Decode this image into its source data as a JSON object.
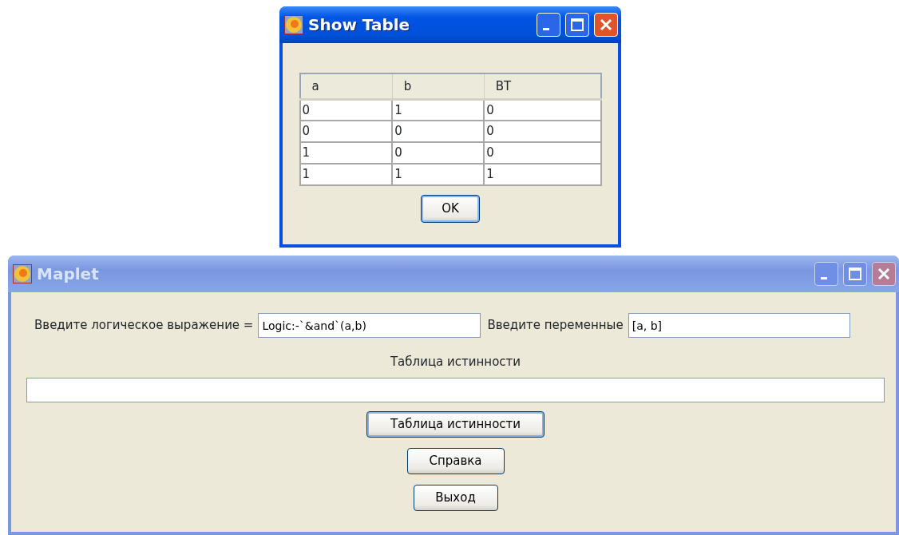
{
  "show_table_window": {
    "title": "Show Table",
    "active": true,
    "table": {
      "columns": [
        "a",
        "b",
        "BT"
      ],
      "rows": [
        [
          "0",
          "1",
          "0"
        ],
        [
          "0",
          "0",
          "0"
        ],
        [
          "1",
          "0",
          "0"
        ],
        [
          "1",
          "1",
          "1"
        ]
      ]
    },
    "ok_button": {
      "label": "OK",
      "focused": true
    }
  },
  "maplet_window": {
    "title": "Maplet",
    "active": false,
    "expression_label": "Введите логическое выражение =",
    "expression_value": "Logic:-`&and`(a,b)",
    "variables_label": "Введите переменные",
    "variables_value": "[a, b]",
    "result_label": "Таблица истинности",
    "buttons": [
      {
        "label": "Таблица истинности",
        "focused": true
      },
      {
        "label": "Справка",
        "focused": false
      },
      {
        "label": "Выход",
        "focused": false
      }
    ]
  }
}
